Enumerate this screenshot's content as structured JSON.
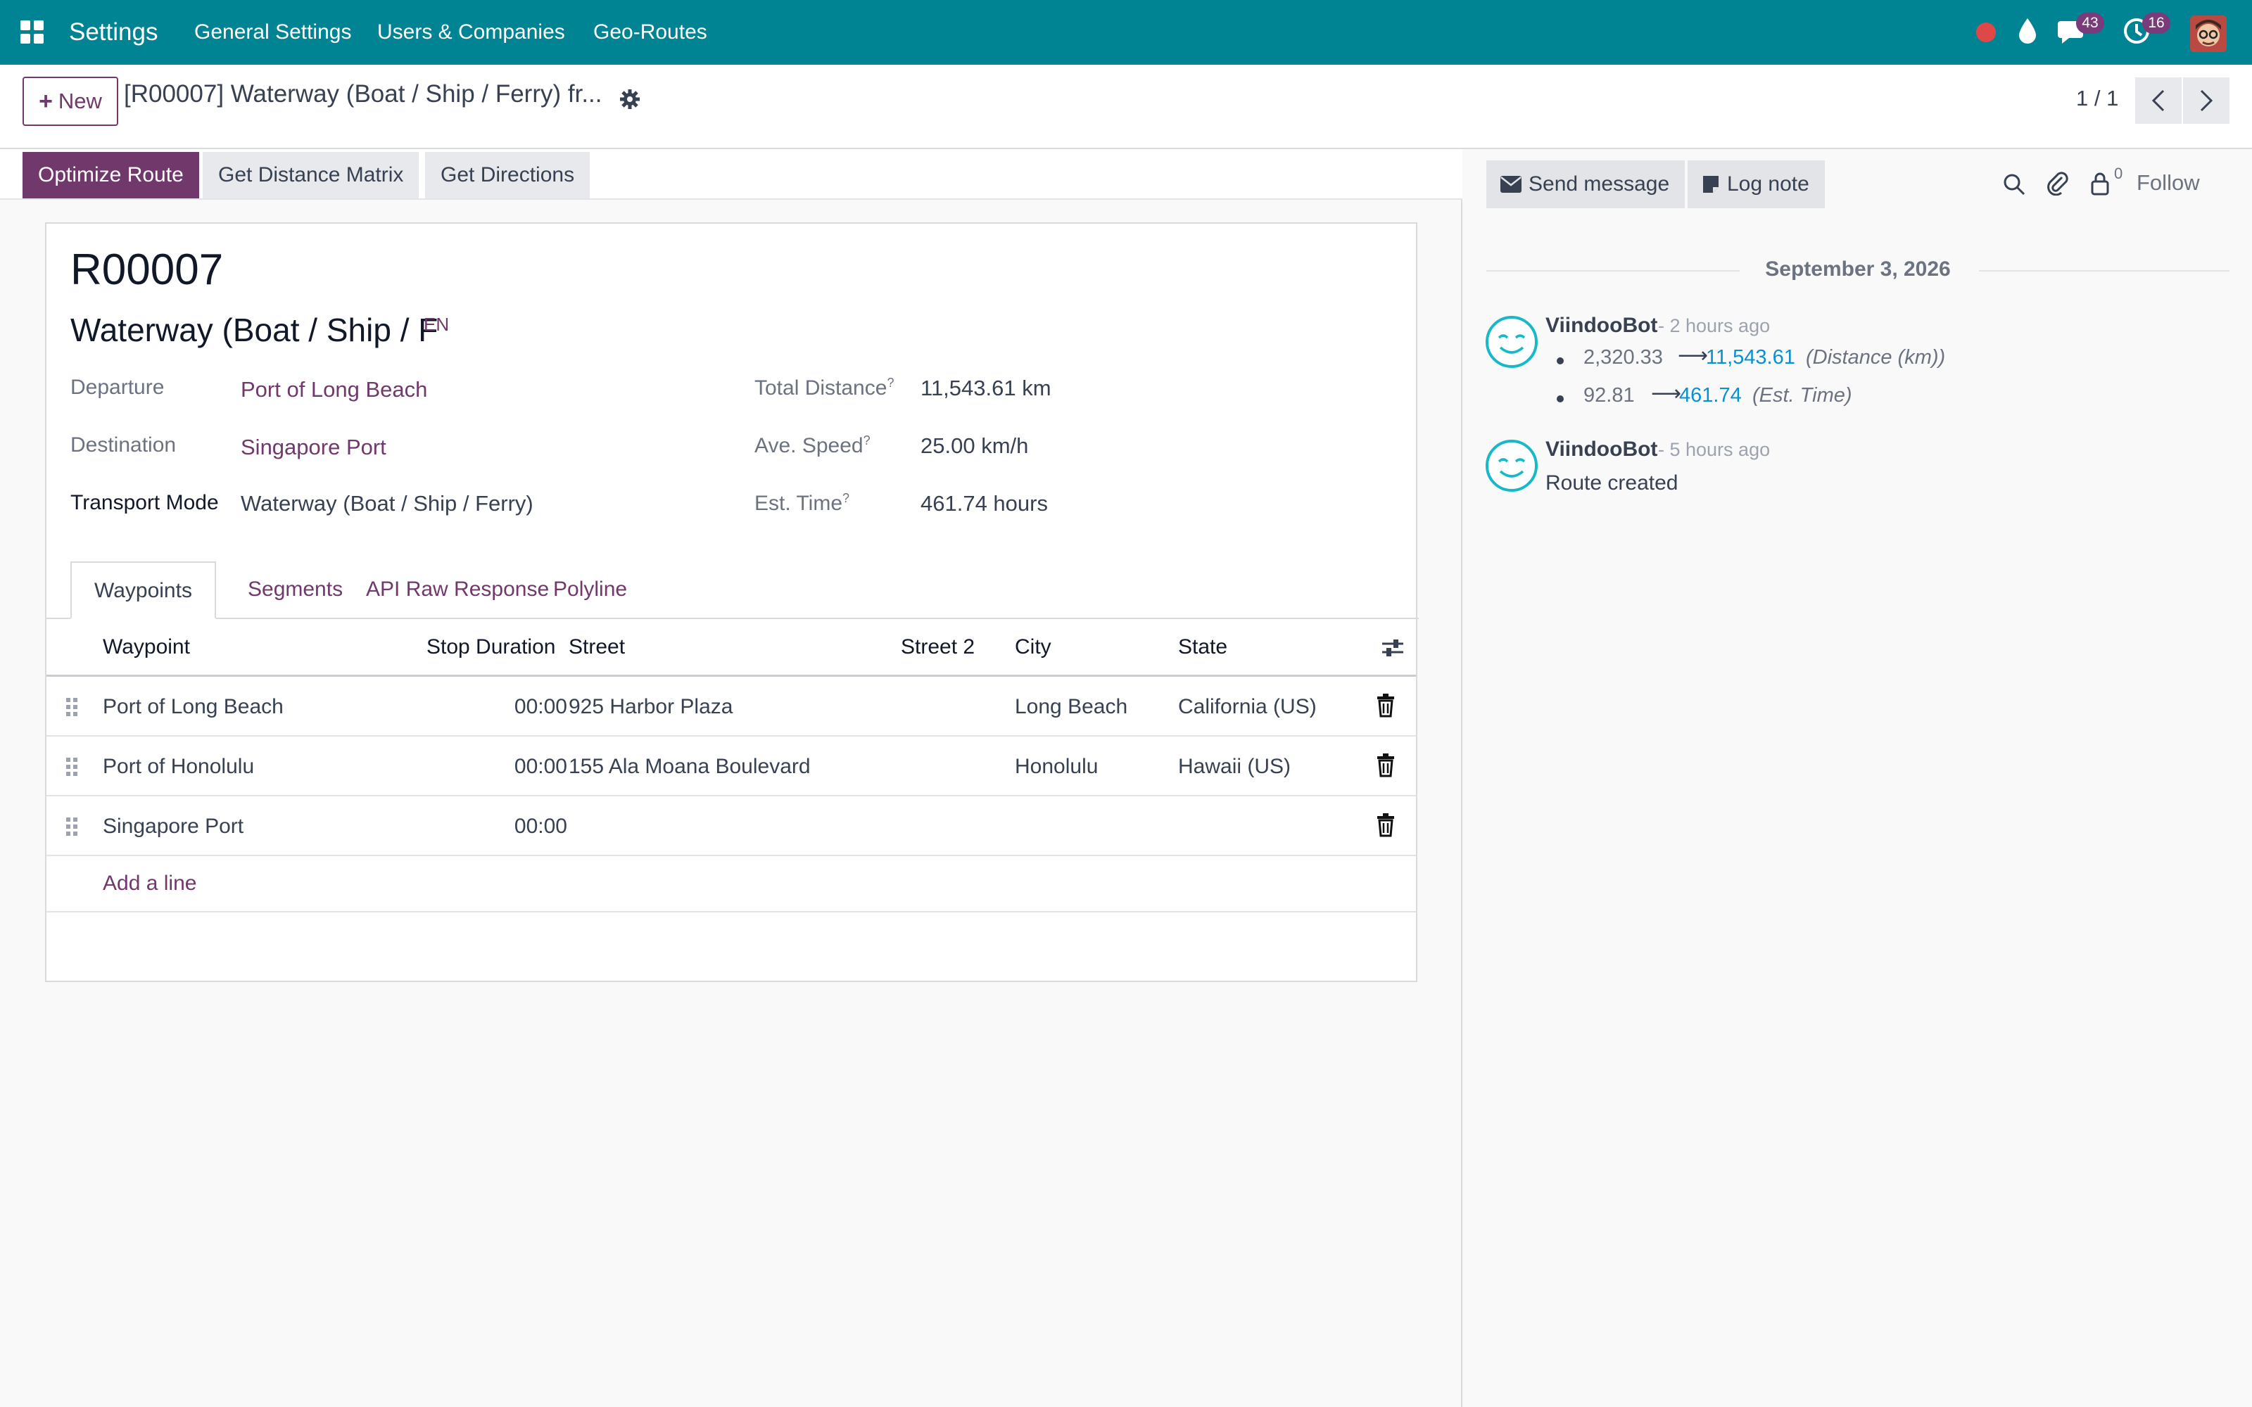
{
  "navbar": {
    "app_title": "Settings",
    "menu": [
      "General Settings",
      "Users & Companies",
      "Geo-Routes"
    ],
    "messages_count": "43",
    "activities_count": "16",
    "bg_color": "#008392"
  },
  "control_panel": {
    "new_label": "New",
    "breadcrumb_title": "[R00007] Waterway (Boat / Ship / Ferry) fr...",
    "pager": "1 / 1"
  },
  "statusbar": {
    "buttons": [
      "Optimize Route",
      "Get Distance Matrix",
      "Get Directions"
    ]
  },
  "record": {
    "name": "R00007",
    "title": "Waterway (Boat / Ship / F",
    "lang": "EN",
    "fields_left": [
      {
        "label": "Departure",
        "value": "Port of Long Beach"
      },
      {
        "label": "Destination",
        "value": "Singapore Port"
      },
      {
        "label": "Transport Mode",
        "value": "Waterway (Boat / Ship / Ferry)"
      }
    ],
    "fields_right": [
      {
        "label": "Total Distance",
        "help": "?",
        "value": "11,543.61 km"
      },
      {
        "label": "Ave. Speed",
        "help": "?",
        "value": "25.00 km/h"
      },
      {
        "label": "Est. Time",
        "help": "?",
        "value": "461.74 hours"
      }
    ]
  },
  "tabs": [
    "Waypoints",
    "Segments",
    "API Raw Response",
    "Polyline"
  ],
  "waypoints": {
    "columns": [
      "Waypoint",
      "Stop Duration",
      "Street",
      "Street 2",
      "City",
      "State"
    ],
    "rows": [
      {
        "waypoint": "Port of Long Beach",
        "stop_duration": "00:00",
        "street": "925 Harbor Plaza",
        "street2": "",
        "city": "Long Beach",
        "state": "California (US)"
      },
      {
        "waypoint": "Port of Honolulu",
        "stop_duration": "00:00",
        "street": "155 Ala Moana Boulevard",
        "street2": "",
        "city": "Honolulu",
        "state": "Hawaii (US)"
      },
      {
        "waypoint": "Singapore Port",
        "stop_duration": "00:00",
        "street": "",
        "street2": "",
        "city": "",
        "state": ""
      }
    ],
    "add_line": "Add a line"
  },
  "chatter": {
    "send_message": "Send message",
    "log_note": "Log note",
    "followers_count": "0",
    "follow": "Follow",
    "date": "September 3, 2026",
    "messages": [
      {
        "author": "ViindooBot",
        "ago": "- 2 hours ago",
        "changes": [
          {
            "old": "2,320.33",
            "new": "11,543.61",
            "field": "(Distance (km))"
          },
          {
            "old": "92.81",
            "new": "461.74",
            "field": "(Est. Time)"
          }
        ]
      },
      {
        "author": "ViindooBot",
        "ago": "- 5 hours ago",
        "body": "Route created"
      }
    ]
  }
}
